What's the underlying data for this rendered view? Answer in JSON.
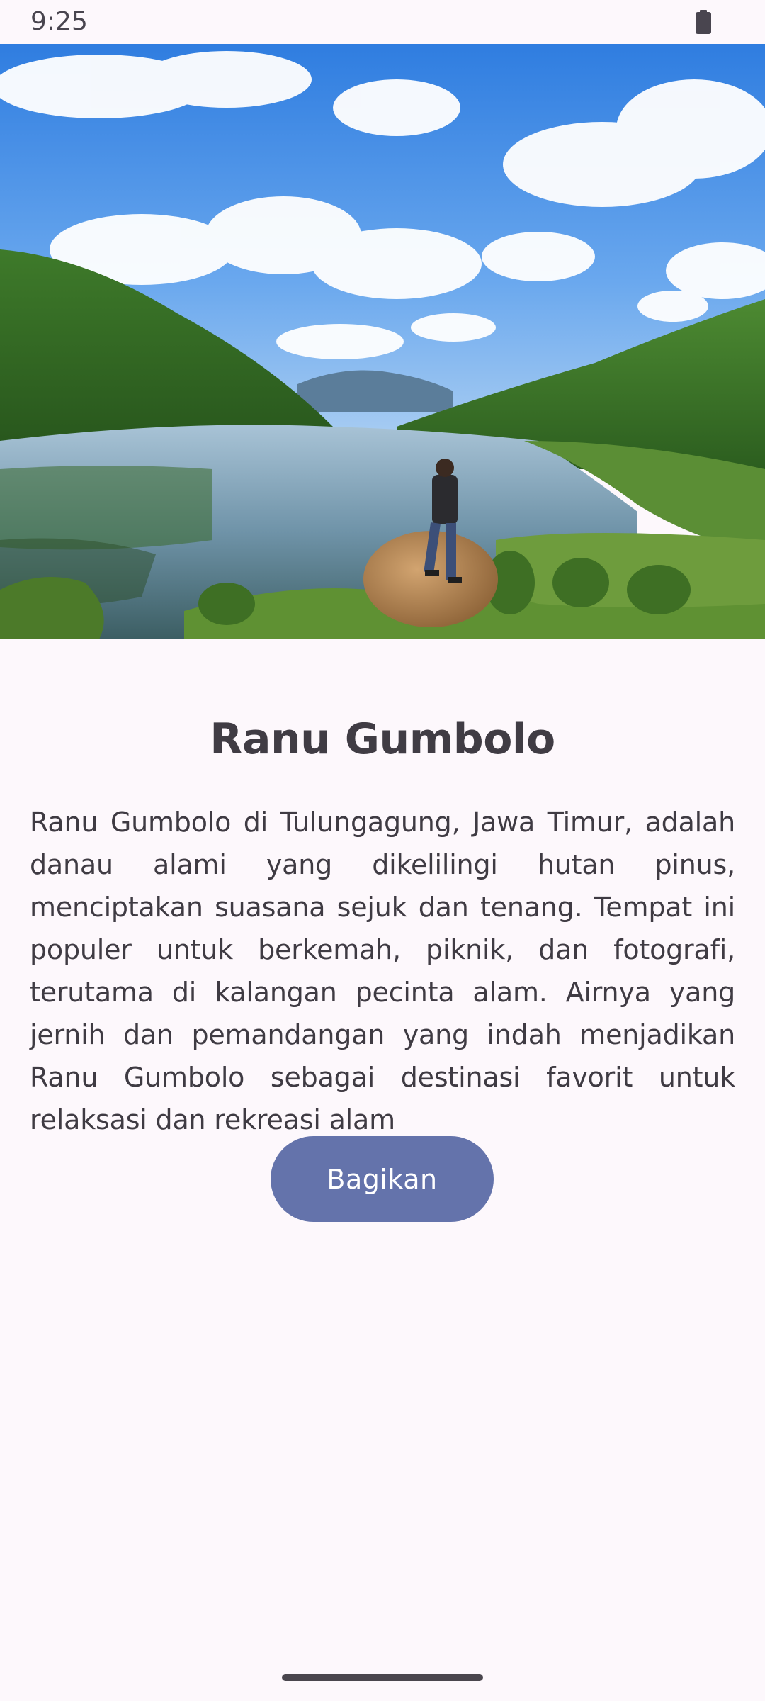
{
  "status_bar": {
    "time": "9:25",
    "battery_icon": "battery-icon"
  },
  "hero": {
    "image_icon": "landscape-photo"
  },
  "content": {
    "title": "Ranu Gumbolo",
    "description": "Ranu Gumbolo di Tulungagung, Jawa Timur, adalah danau alami yang dikelilingi hutan pinus, menciptakan suasana sejuk dan tenang. Tempat ini populer untuk berkemah, piknik, dan fotografi, terutama di kalangan pecinta alam. Airnya yang jernih dan pemandangan yang indah menjadikan Ranu Gumbolo sebagai destinasi favorit untuk relaksasi dan rekreasi alam"
  },
  "actions": {
    "share_label": "Bagikan"
  },
  "colors": {
    "background": "#fdf8fc",
    "button": "#6473ab",
    "text": "#3f3b43"
  }
}
